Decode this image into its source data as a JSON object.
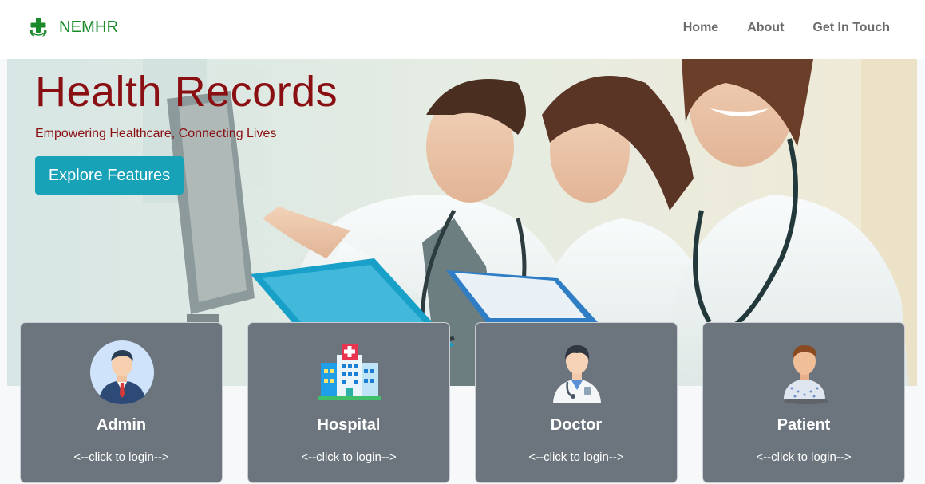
{
  "brand": {
    "name": "NEMHR"
  },
  "nav": {
    "items": [
      "Home",
      "About",
      "Get In Touch"
    ]
  },
  "hero": {
    "title": "Health Records",
    "subtitle": "Empowering Healthcare, Connecting Lives",
    "button_label": "Explore Features"
  },
  "cards": [
    {
      "title": "Admin",
      "cta": "<--click to login-->",
      "icon": "admin-avatar-icon"
    },
    {
      "title": "Hospital",
      "cta": "<--click to login-->",
      "icon": "hospital-building-icon"
    },
    {
      "title": "Doctor",
      "cta": "<--click to login-->",
      "icon": "doctor-avatar-icon"
    },
    {
      "title": "Patient",
      "cta": "<--click to login-->",
      "icon": "patient-avatar-icon"
    }
  ],
  "colors": {
    "brand_green": "#1a8a2a",
    "hero_text": "#8a0f12",
    "button": "#17a2b8",
    "card_bg": "#6c757d"
  }
}
